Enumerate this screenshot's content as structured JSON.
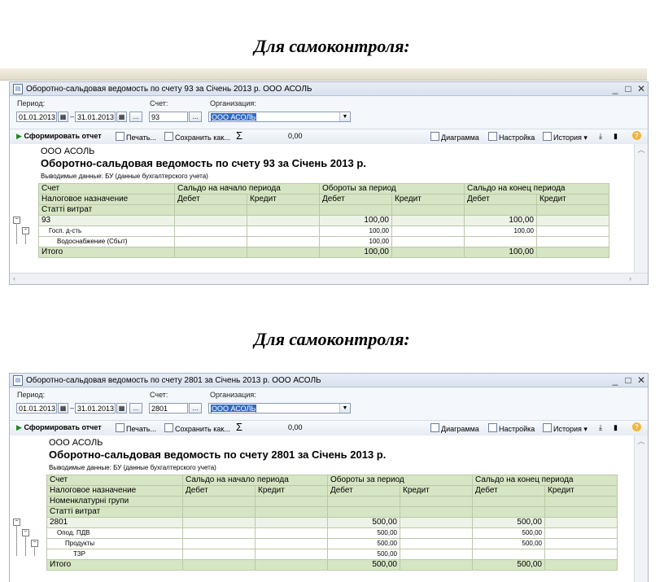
{
  "heading": "Для самоконтроля:",
  "window1": {
    "title": "Оборотно-сальдовая ведомость по счету 93 за Січень 2013 р. ООО АСОЛЬ",
    "period_label": "Период:",
    "date_from": "01.01.2013",
    "date_to": "31.01.2013",
    "account_label": "Счет:",
    "account": "93",
    "org_label": "Организация:",
    "org": "ООО АСОЛЬ",
    "toolbar": {
      "generate": "Сформировать отчет",
      "print": "Печать...",
      "save": "Сохранить как...",
      "sigma": "Σ",
      "sum": "0,00",
      "diagram": "Диаграмма",
      "settings": "Настройка",
      "history": "История"
    },
    "report": {
      "org": "ООО АСОЛЬ",
      "title": "Оборотно-сальдовая ведомость по счету 93 за Січень 2013 р.",
      "output": "Выводимые данные: БУ (данные бухгалтерского учета)",
      "headers": {
        "account": "Счет",
        "opening": "Сальдо на начало периода",
        "turnover": "Обороты за период",
        "closing": "Сальдо на конец периода",
        "debit": "Дебет",
        "credit": "Кредит",
        "h2": "Налоговое назначение",
        "h3": "Статті витрат"
      },
      "rows": [
        {
          "name": "93",
          "turn_debit": "100,00",
          "close_debit": "100,00"
        },
        {
          "name": "Госп. д-сть",
          "turn_debit": "100,00",
          "close_debit": "100,00"
        },
        {
          "name": "Водоснабжение (Сбыт)",
          "turn_debit": "100,00",
          "close_debit": ""
        }
      ],
      "total": {
        "name": "Итого",
        "turn_debit": "100,00",
        "close_debit": "100,00"
      }
    }
  },
  "window2": {
    "title": "Оборотно-сальдовая ведомость по счету 2801 за Січень 2013 р. ООО АСОЛЬ",
    "period_label": "Период:",
    "date_from": "01.01.2013",
    "date_to": "31.01.2013",
    "account_label": "Счет:",
    "account": "2801",
    "org_label": "Организация:",
    "org": "ООО АСОЛЬ",
    "toolbar": {
      "generate": "Сформировать отчет",
      "print": "Печать...",
      "save": "Сохранить как...",
      "sigma": "Σ",
      "sum": "0,00",
      "diagram": "Диаграмма",
      "settings": "Настройка",
      "history": "История"
    },
    "report": {
      "org": "ООО АСОЛЬ",
      "title": "Оборотно-сальдовая ведомость по счету 2801 за Січень 2013 р.",
      "output": "Выводимые данные: БУ (данные бухгалтерского учета)",
      "headers": {
        "account": "Счет",
        "opening": "Сальдо на начало периода",
        "turnover": "Обороты за период",
        "closing": "Сальдо на конец периода",
        "debit": "Дебет",
        "credit": "Кредит",
        "h2": "Налоговое назначение",
        "h3": "Номенклатурні групи",
        "h4": "Статті витрат"
      },
      "rows": [
        {
          "name": "2801",
          "turn_debit": "500,00",
          "close_debit": "500,00"
        },
        {
          "name": "Опод. ПДВ",
          "turn_debit": "500,00",
          "close_debit": "500,00"
        },
        {
          "name": "Продукты",
          "turn_debit": "500,00",
          "close_debit": "500,00"
        },
        {
          "name": "ТЗР",
          "turn_debit": "500,00",
          "close_debit": ""
        }
      ],
      "total": {
        "name": "Итого",
        "turn_debit": "500,00",
        "close_debit": "500,00"
      }
    }
  }
}
